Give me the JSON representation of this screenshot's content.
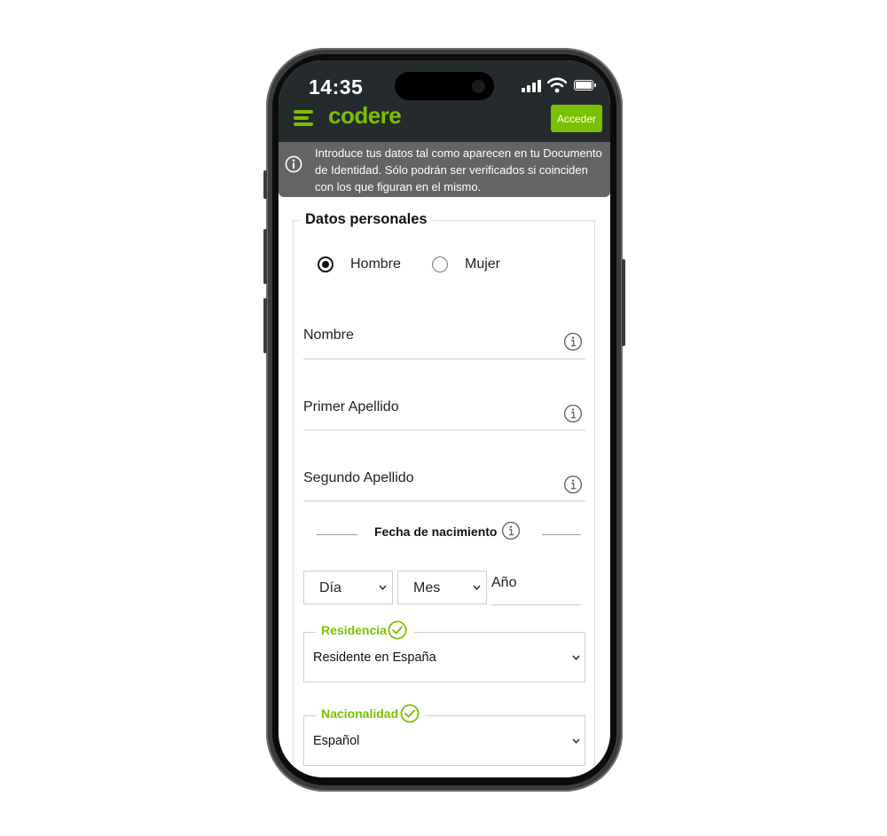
{
  "status_bar": {
    "time": "14:35"
  },
  "header": {
    "logo": "codere",
    "login_label": "Acceder"
  },
  "notice": {
    "text": "Introduce tus datos tal como aparecen en tu Documento de Identidad. Sólo podrán ser verificados si coinciden con los que figuran en el mismo."
  },
  "form": {
    "section_title": "Datos personales",
    "gender": {
      "options": [
        "Hombre",
        "Mujer"
      ],
      "selected": "Hombre"
    },
    "fields": {
      "first_name": "Nombre",
      "last_name_1": "Primer Apellido",
      "last_name_2": "Segundo Apellido"
    },
    "dob": {
      "title": "Fecha de nacimiento",
      "day": "Día",
      "month": "Mes",
      "year": "Año"
    },
    "residence": {
      "label": "Residencia",
      "value": "Residente en España"
    },
    "nationality": {
      "label": "Nacionalidad",
      "value": "Español"
    }
  },
  "colors": {
    "brand_green": "#79c000",
    "header_bg": "#252a2c",
    "notice_bg": "#626466"
  }
}
